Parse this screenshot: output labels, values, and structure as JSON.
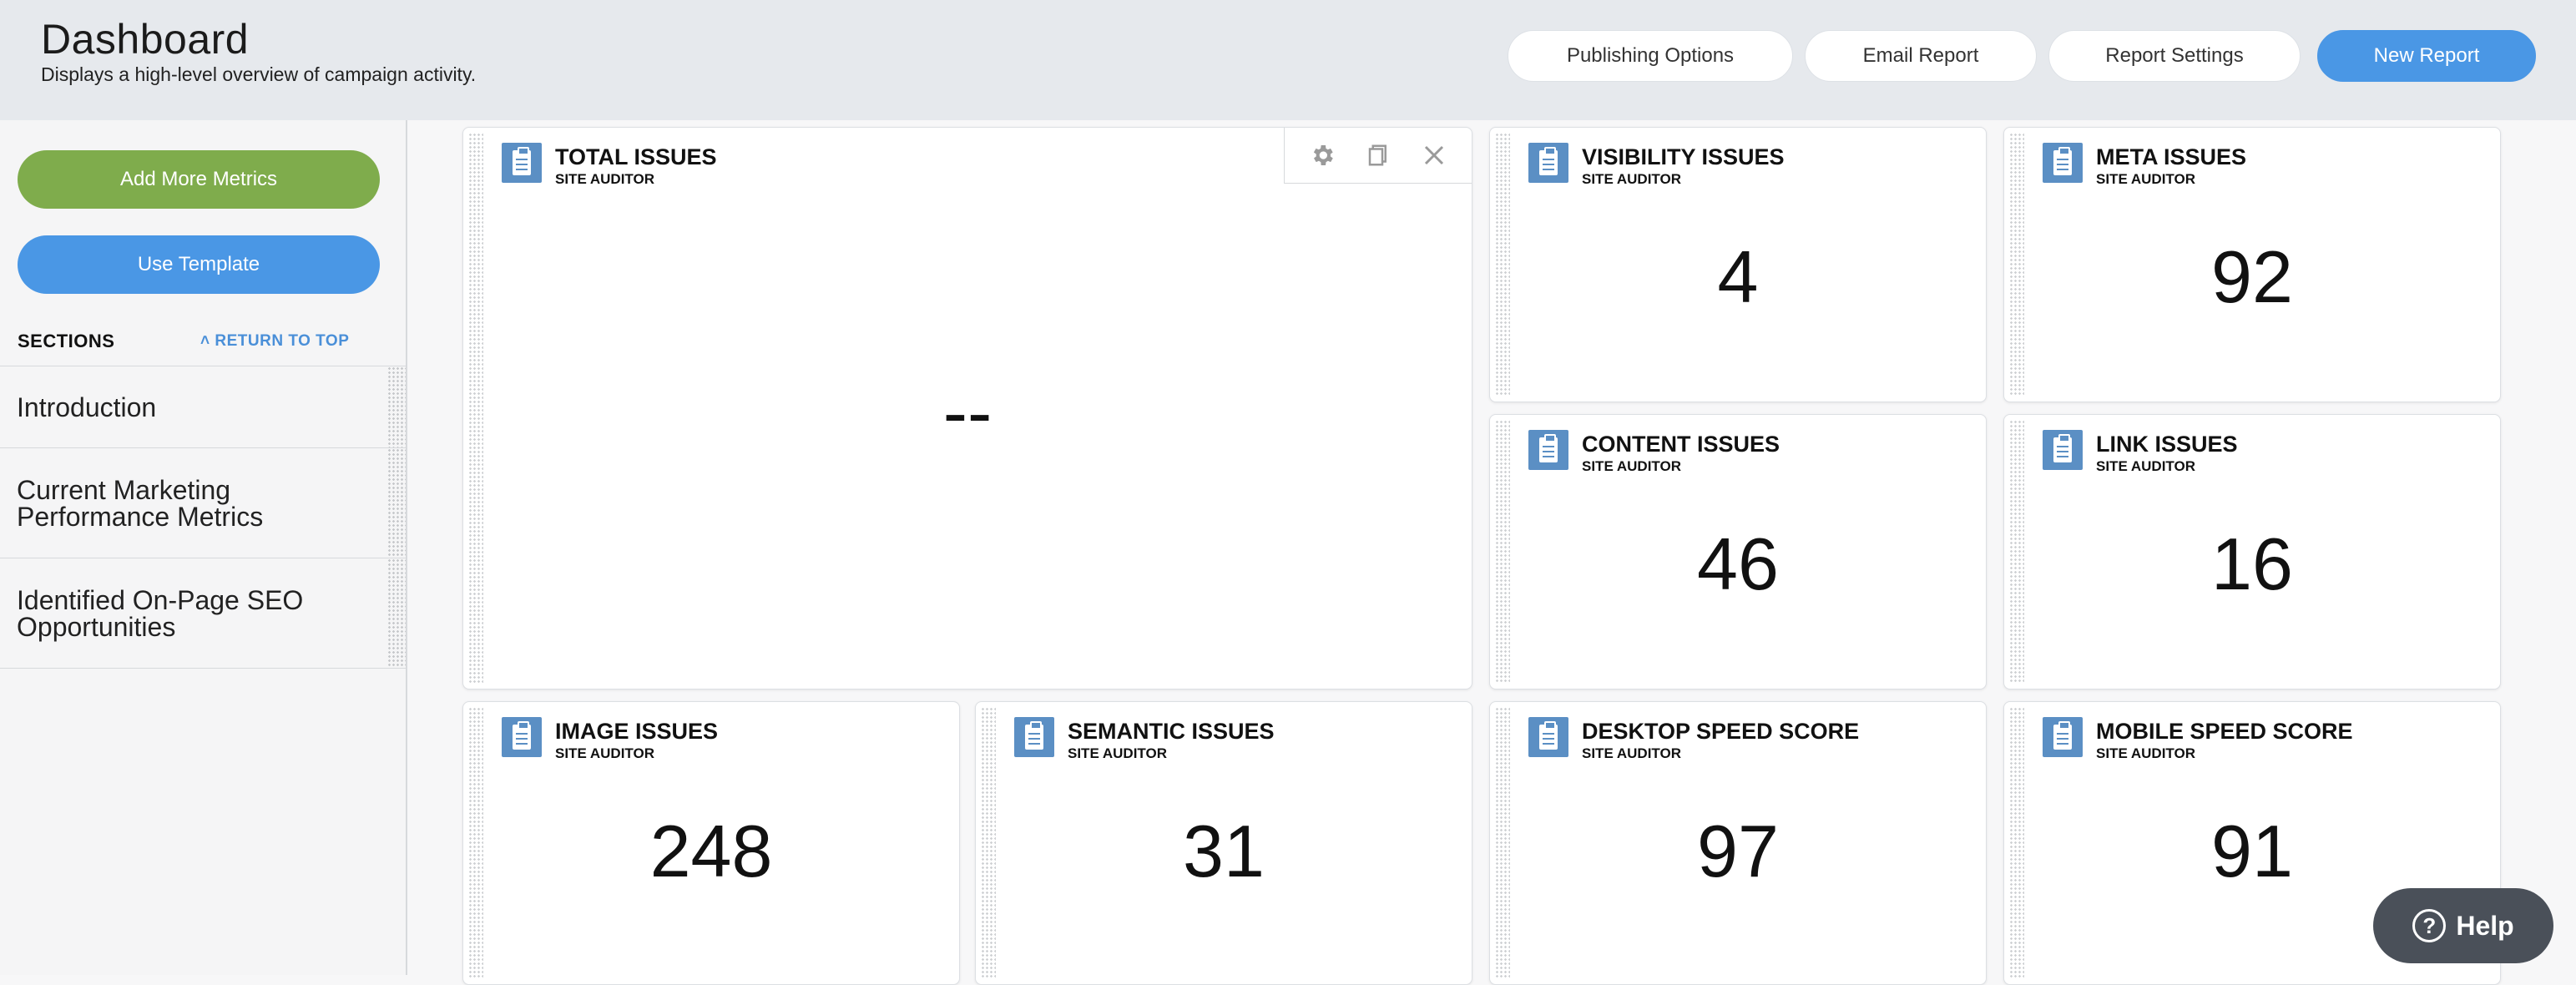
{
  "header": {
    "title": "Dashboard",
    "subtitle": "Displays a high-level overview of campaign activity.",
    "buttons": {
      "publishing": "Publishing Options",
      "email": "Email Report",
      "settings": "Report Settings",
      "new_report": "New Report"
    }
  },
  "sidebar": {
    "add_metrics": "Add More Metrics",
    "use_template": "Use Template",
    "sections_label": "SECTIONS",
    "return_top": "RETURN TO TOP",
    "sections": [
      "Introduction",
      "Current Marketing Performance Metrics",
      "Identified On-Page SEO Opportunities"
    ]
  },
  "widgets": [
    {
      "title": "TOTAL ISSUES",
      "source": "SITE AUDITOR",
      "value": "--"
    },
    {
      "title": "VISIBILITY ISSUES",
      "source": "SITE AUDITOR",
      "value": "4"
    },
    {
      "title": "META ISSUES",
      "source": "SITE AUDITOR",
      "value": "92"
    },
    {
      "title": "CONTENT ISSUES",
      "source": "SITE AUDITOR",
      "value": "46"
    },
    {
      "title": "LINK ISSUES",
      "source": "SITE AUDITOR",
      "value": "16"
    },
    {
      "title": "IMAGE ISSUES",
      "source": "SITE AUDITOR",
      "value": "248"
    },
    {
      "title": "SEMANTIC ISSUES",
      "source": "SITE AUDITOR",
      "value": "31"
    },
    {
      "title": "DESKTOP SPEED SCORE",
      "source": "SITE AUDITOR",
      "value": "97"
    },
    {
      "title": "MOBILE SPEED SCORE",
      "source": "SITE AUDITOR",
      "value": "91"
    }
  ],
  "help": {
    "label": "Help"
  },
  "icons": {
    "widget": "clipboard-icon",
    "settings": "gear-icon",
    "duplicate": "copy-icon",
    "remove": "close-icon",
    "return_top": "chevron-up-icon",
    "help": "question-circle-icon"
  },
  "colors": {
    "primary": "#4a97e5",
    "green": "#7fac4c",
    "icon_blue": "#5b8fc4",
    "help_bg": "#4a5059"
  }
}
